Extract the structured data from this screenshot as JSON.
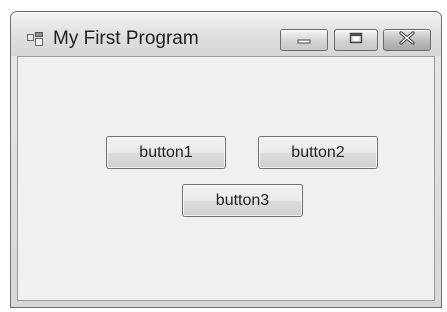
{
  "window": {
    "title": "My First Program",
    "controls": {
      "minimize": "minimize-icon",
      "maximize": "maximize-icon",
      "close": "close-icon"
    }
  },
  "buttons": [
    {
      "label": "button1"
    },
    {
      "label": "button2"
    },
    {
      "label": "button3"
    }
  ]
}
